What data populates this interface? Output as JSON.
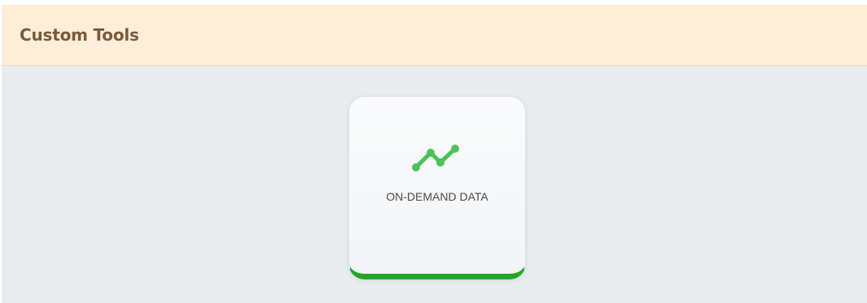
{
  "panel": {
    "title": "Custom Tools"
  },
  "tiles": [
    {
      "label": "ON-DEMAND DATA",
      "icon": "line-chart-icon",
      "accent_color": "#24a524",
      "icon_color": "#4cc15a"
    }
  ]
}
